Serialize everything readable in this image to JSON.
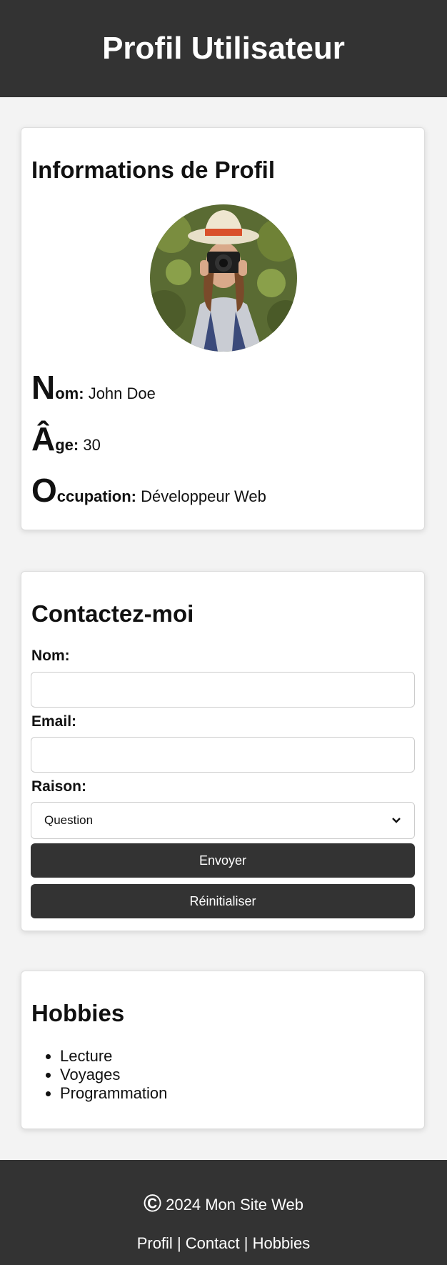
{
  "header": {
    "title": "Profil Utilisateur"
  },
  "profile": {
    "heading": "Informations de Profil",
    "photo_icon": "camera-photographer-photo",
    "fields": [
      {
        "initial": "N",
        "label_rest": "om:",
        "value": "John Doe"
      },
      {
        "initial": "Â",
        "label_rest": "ge:",
        "value": "30"
      },
      {
        "initial": "O",
        "label_rest": "ccupation:",
        "value": "Développeur Web"
      }
    ]
  },
  "contact": {
    "heading": "Contactez-moi",
    "name_label": "Nom:",
    "name_value": "",
    "email_label": "Email:",
    "email_value": "",
    "reason_label": "Raison:",
    "reason_selected": "Question",
    "submit_label": "Envoyer",
    "reset_label": "Réinitialiser"
  },
  "hobbies": {
    "heading": "Hobbies",
    "items": [
      "Lecture",
      "Voyages",
      "Programmation"
    ]
  },
  "footer": {
    "copyright_symbol": "©",
    "copyright_text": "2024 Mon Site Web",
    "links": [
      "Profil",
      "Contact",
      "Hobbies"
    ],
    "separator": "|"
  },
  "colors": {
    "dark": "#333333",
    "background": "#f3f3f3",
    "card": "#ffffff"
  }
}
